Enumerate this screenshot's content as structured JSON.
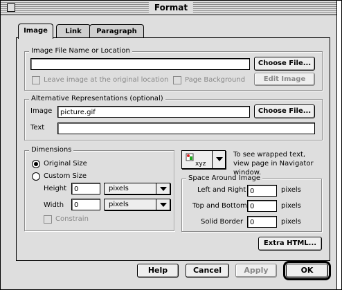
{
  "window": {
    "title": "Format"
  },
  "tabs": [
    {
      "label": "Image",
      "active": true
    },
    {
      "label": "Link",
      "active": false
    },
    {
      "label": "Paragraph",
      "active": false
    }
  ],
  "image_file": {
    "group_label": "Image File Name or Location",
    "value": "",
    "choose_label": "Choose File...",
    "leave_label": "Leave image at the original location",
    "background_label": "Page Background",
    "edit_label": "Edit Image"
  },
  "alt": {
    "group_label": "Alternative Representations (optional)",
    "image_label": "Image",
    "image_value": "picture.gif",
    "choose_label": "Choose File...",
    "text_label": "Text",
    "text_value": ""
  },
  "dimensions": {
    "group_label": "Dimensions",
    "original_label": "Original Size",
    "custom_label": "Custom Size",
    "height_label": "Height",
    "height_value": "0",
    "height_unit": "pixels",
    "width_label": "Width",
    "width_value": "0",
    "width_unit": "pixels",
    "constrain_label": "Constrain"
  },
  "wrap": {
    "icon_text": "xyz",
    "note": "To see wrapped text, view page in Navigator window."
  },
  "space": {
    "group_label": "Space Around Image",
    "lr_label": "Left and Right",
    "lr_value": "0",
    "tb_label": "Top and Bottom",
    "tb_value": "0",
    "border_label": "Solid Border",
    "border_value": "0",
    "unit": "pixels"
  },
  "extra_html_label": "Extra HTML...",
  "buttons": {
    "help": "Help",
    "cancel": "Cancel",
    "apply": "Apply",
    "ok": "OK"
  }
}
